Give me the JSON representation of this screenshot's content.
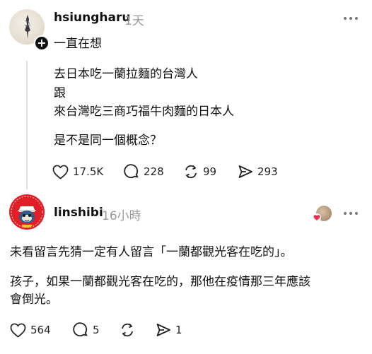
{
  "post1": {
    "username": "hsiungharu",
    "time": "1天",
    "intro": "一直在想",
    "lines": [
      "去日本吃一蘭拉麵的台灣人",
      "跟",
      "來台灣吃三商巧福牛肉麵的日本人"
    ],
    "question": "是不是同一個概念？",
    "likes": "17.5K",
    "comments": "228",
    "reposts": "99",
    "shares": "293"
  },
  "post2": {
    "username": "linshibi",
    "time": "16小時",
    "paragraph1": "未看留言先猜一定有人留言「一蘭都觀光客在吃的」。",
    "paragraph2_line1": "孩子，如果一蘭都觀光客在吃的，那他在疫情那三年應該",
    "paragraph2_line2": "會倒光。",
    "likes": "564",
    "comments": "5",
    "shares": "1"
  },
  "colors": {
    "accent_red": "#e01f27",
    "muted": "#9a9a9a",
    "text": "#111111"
  },
  "icons": [
    "heart-icon",
    "comment-icon",
    "repost-icon",
    "share-icon",
    "more-icon",
    "follow-plus-icon"
  ]
}
